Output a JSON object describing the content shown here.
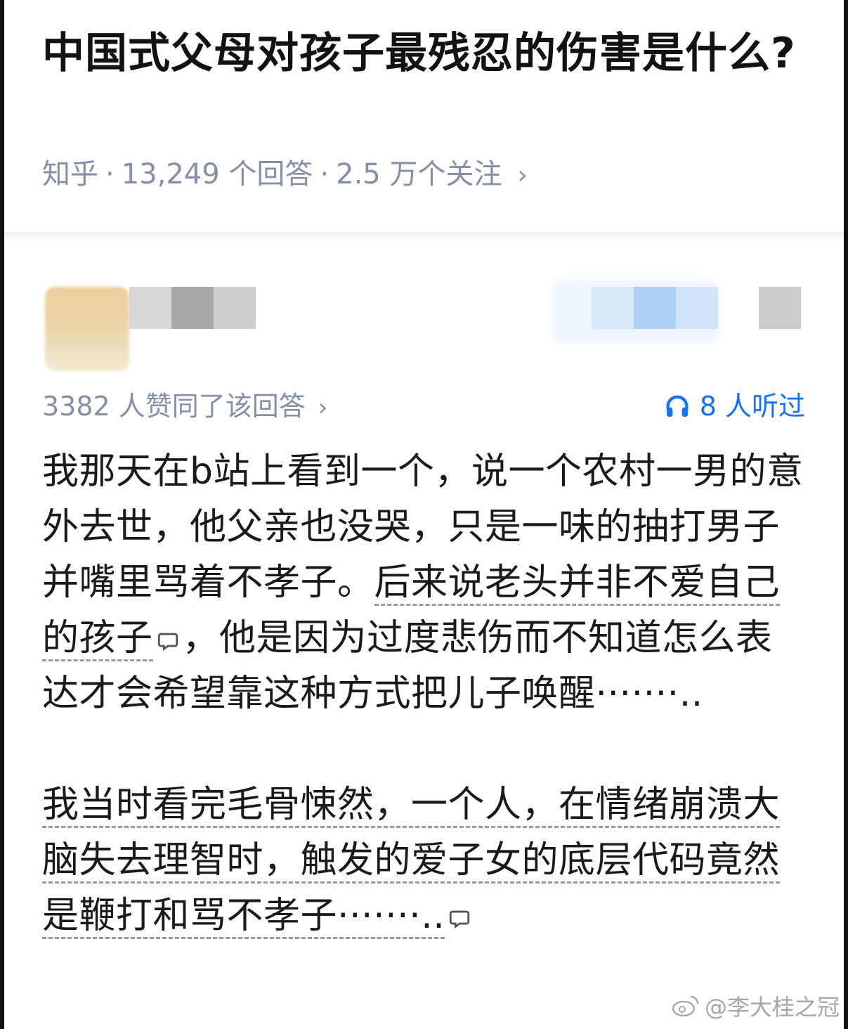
{
  "question": {
    "title": "中国式父母对孩子最残忍的伤害是什么?",
    "source": "知乎",
    "answers": "13,249 个回答",
    "follows": "2.5 万个关注",
    "chevron": "›"
  },
  "answer_meta": {
    "votes": "3382 人赞同了该回答",
    "chevron": "›",
    "listeners": "8 人听过",
    "listen_icon": "headphones-icon",
    "accent_color": "#1772f6"
  },
  "answer": {
    "p1_a": "我那天在b站上看到一个，说一个农村一男的意外去世，他父亲也没哭，只是一味的抽打男子并嘴里骂着不孝子。",
    "p1_b": "后来说老头并非不爱自己的孩子",
    "p1_c": "，他是因为过度悲伤而不知道怎么表达才会希望靠这种方式把儿子唤醒·······..",
    "p2": "我当时看完毛骨悚然，一个人，在情绪崩溃大脑失去理智时，触发的爱子女的底层代码竟然是鞭打和骂不孝子·······.."
  },
  "watermark": {
    "text": "@李大桂之冠",
    "icon": "weibo-icon"
  }
}
